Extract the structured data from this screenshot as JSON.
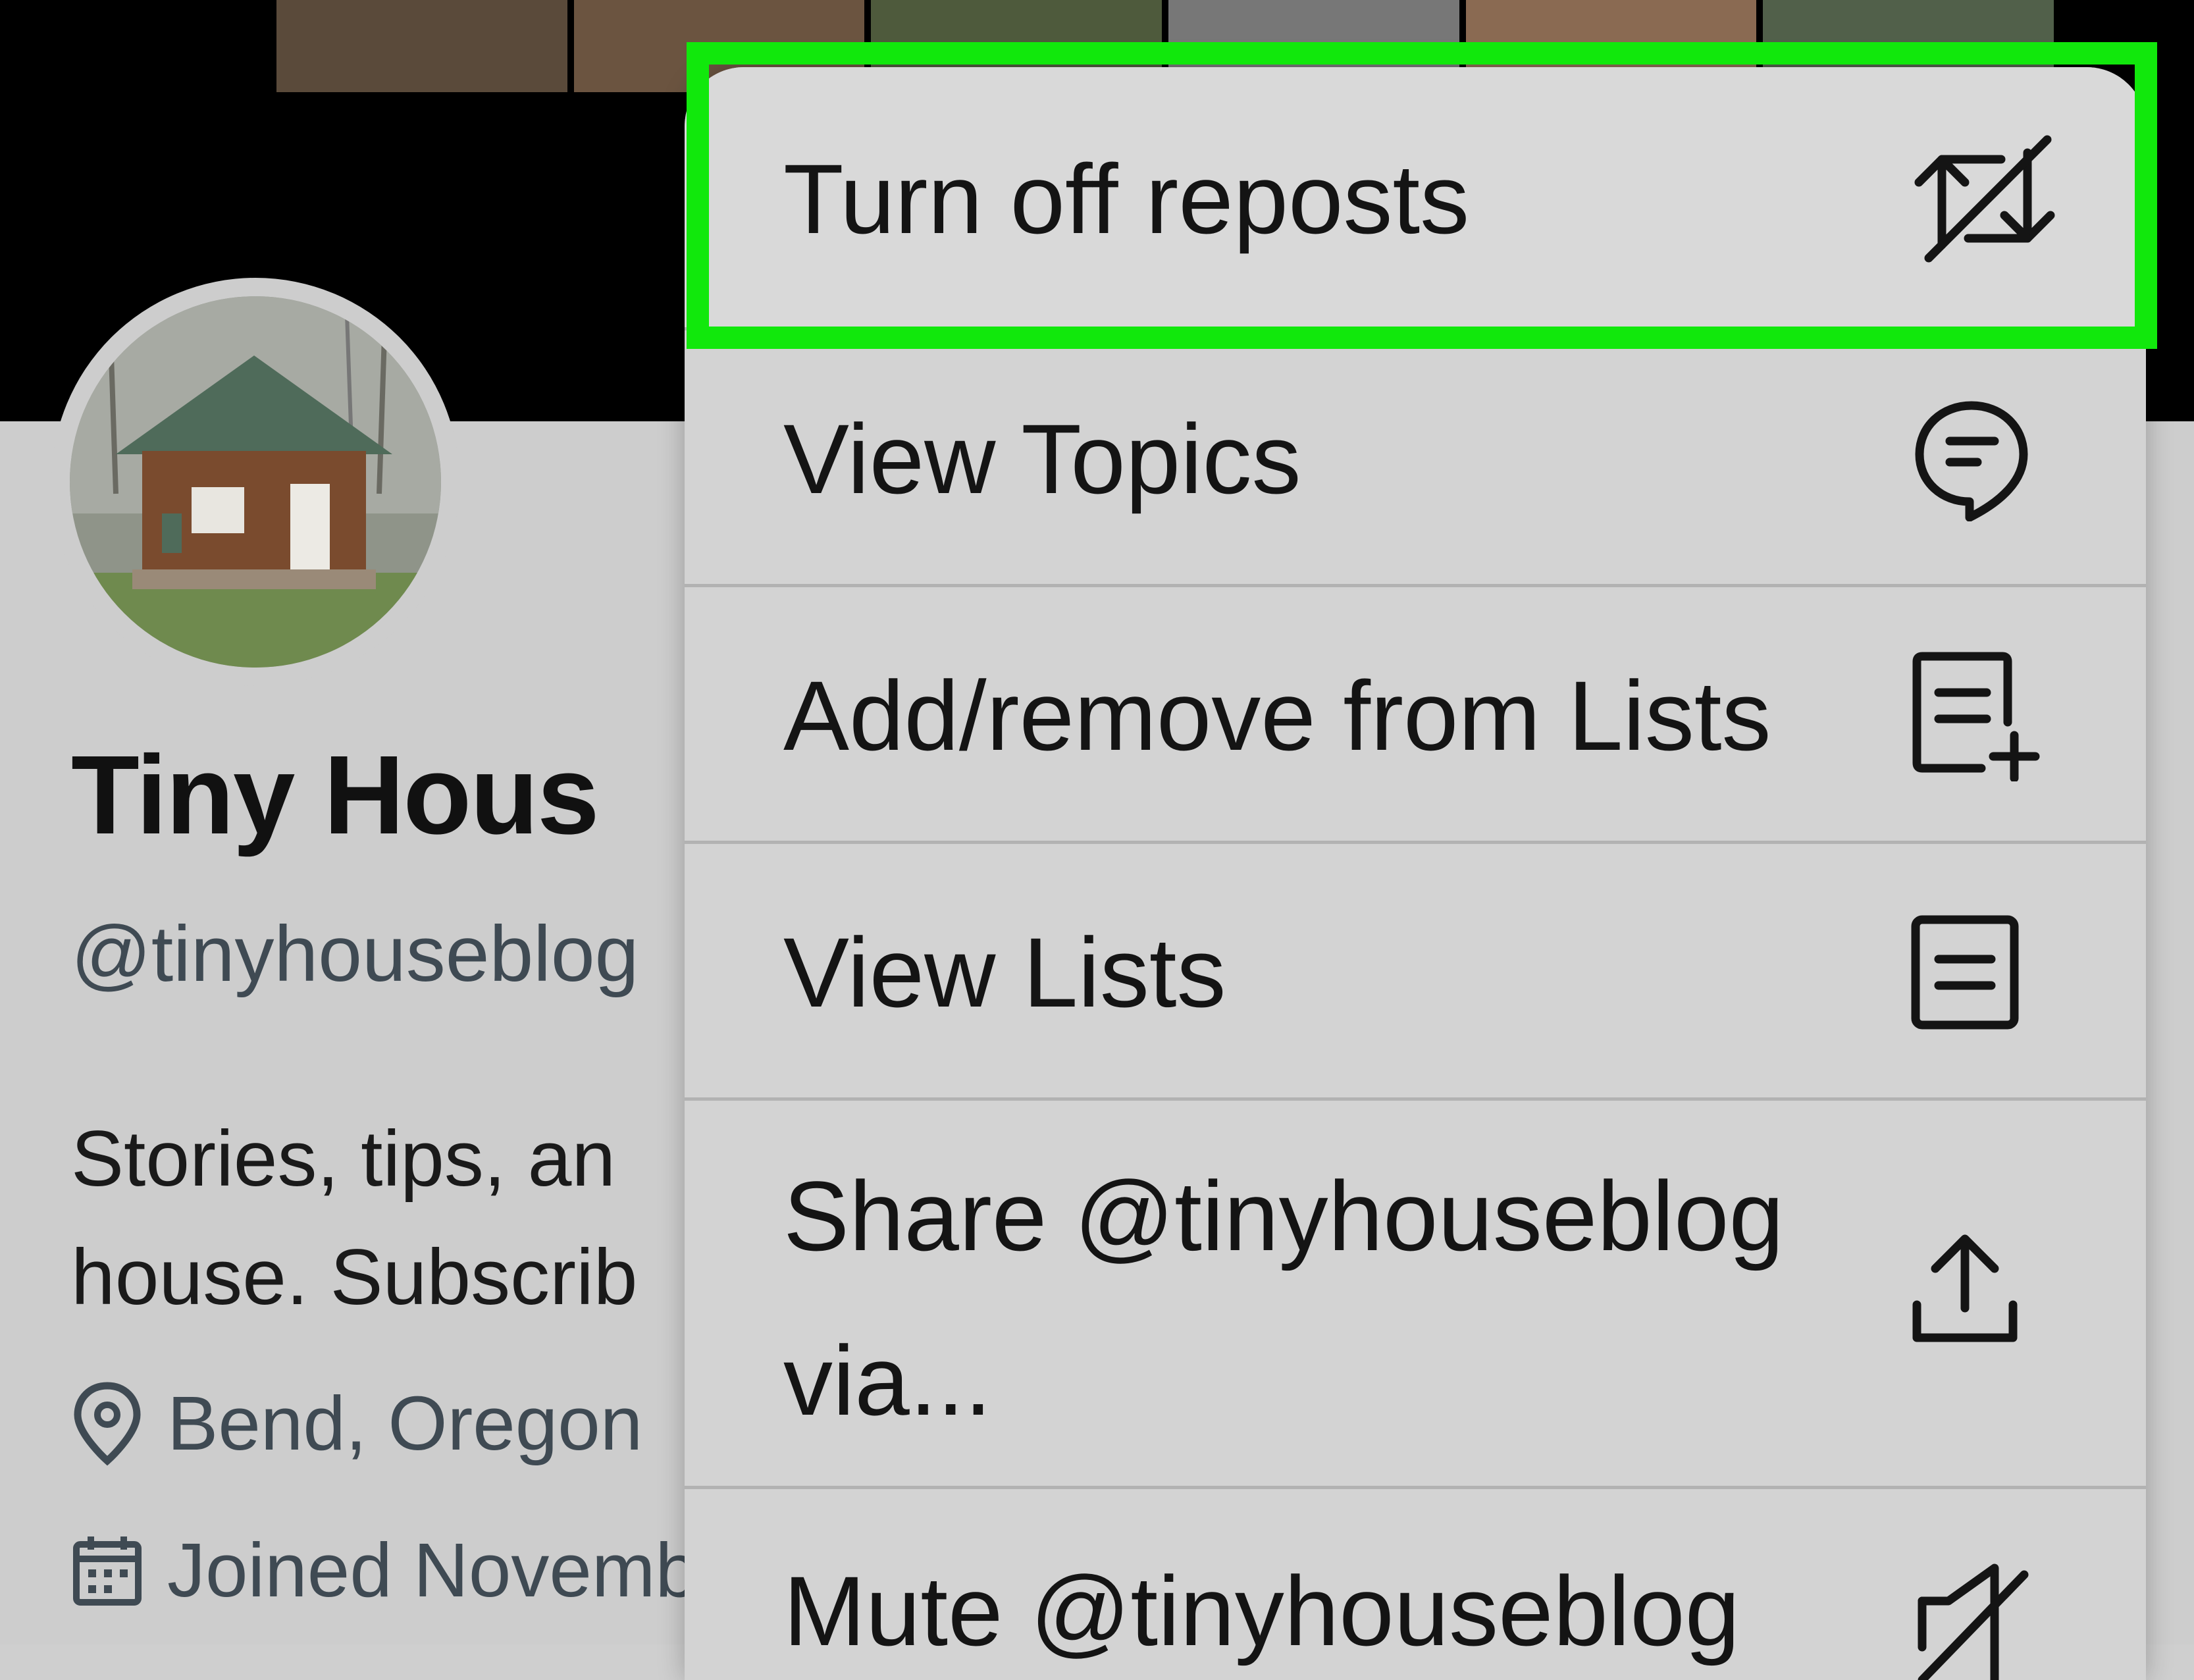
{
  "profile": {
    "display_name": "Tiny Hous",
    "handle": "@tinyhouseblog",
    "bio_lines": [
      "Stories, tips, an",
      "house. Subscrib"
    ],
    "location": "Bend, Oregon",
    "joined": "Joined Novemb"
  },
  "menu": {
    "items": [
      {
        "label": "Turn off reposts",
        "icon": "repost-off-icon",
        "highlighted": true
      },
      {
        "label": "View Topics",
        "icon": "topics-icon"
      },
      {
        "label": "Add/remove from Lists",
        "icon": "list-add-icon"
      },
      {
        "label": "View Lists",
        "icon": "list-icon"
      },
      {
        "label": "Share @tinyhouseblog\nvia...",
        "icon": "share-icon"
      },
      {
        "label": "Mute @tinyhouseblog",
        "icon": "mute-icon"
      }
    ]
  },
  "colors": {
    "highlight_frame": "#11e80c",
    "menu_background": "#d3d3d3",
    "text": "#141414",
    "secondary_text": "#3f4a53"
  }
}
